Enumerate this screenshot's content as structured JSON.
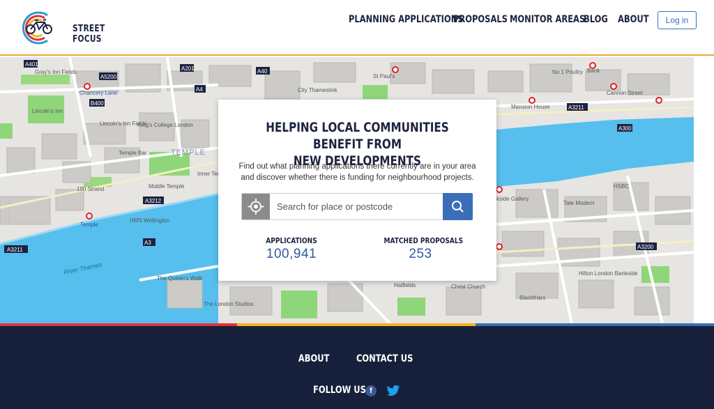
{
  "brand": {
    "line1": "STREET",
    "line2": "FOCUS",
    "colors": {
      "navy": "#1d2340",
      "blue": "#3a6fb8",
      "yellow": "#f2b51b",
      "red": "#e1323c",
      "teal": "#2c9ad1"
    }
  },
  "nav": {
    "items": [
      {
        "label": "PLANNING APPLICATIONS"
      },
      {
        "label": "PROPOSALS"
      },
      {
        "label": "MONITOR AREAS"
      },
      {
        "label": "BLOG"
      },
      {
        "label": "ABOUT"
      }
    ],
    "login_label": "Log in"
  },
  "map": {
    "labels": {
      "temple_area": "TEMPLE",
      "river": "River Thames",
      "hms": "HMS Wellington",
      "temple_stn": "Temple",
      "lincolns": "Lincoln's Inn",
      "lincolns_fields": "Lincoln's Inn Fields",
      "grays": "Gray's Inn Fields",
      "chancery": "Chancery Lane",
      "kings": "King's College London",
      "middle_temple": "Middle Temple",
      "inner_temple": "Inner Temple Garden",
      "strand190": "190 Strand",
      "queens_walk": "The Queen's Walk",
      "london_studios": "The London Studios",
      "mansion": "Mansion House",
      "cannon": "Cannon Street",
      "hsbc": "HSBC",
      "tate": "Tate Modern",
      "bankside": "kside Gallery",
      "christ": "Christ Church",
      "hilton": "Hilton London Bankside",
      "stpauls": "St Paul's",
      "city": "City Thameslink",
      "no1": "No 1 Poultry",
      "bank": "Bank",
      "temple_bar": "Temple Bar",
      "road_a3211_left": "A3211",
      "road_a3211_right": "A3211",
      "road_a3200": "A3200",
      "road_a300": "A300",
      "road_a4": "A4",
      "road_a40": "A40",
      "road_a401": "A401",
      "road_a5200": "A5200",
      "road_a3212": "A3212",
      "road_a201": "A201",
      "road_b400": "B400",
      "road_a3": "A3",
      "hatfields": "Hatfields",
      "blackfriars": "Blackfriars"
    }
  },
  "hero": {
    "title_line1": "HELPING LOCAL COMMUNITIES BENEFIT FROM",
    "title_line2": "NEW DEVELOPMENTS",
    "desc_line1": "Find out what planning applications there currently are in your area",
    "desc_line2": "and discover whether there is funding for neighbourhood projects.",
    "search_placeholder": "Search for place or postcode",
    "stats": [
      {
        "label": "APPLICATIONS",
        "value": "100,941"
      },
      {
        "label": "MATCHED PROPOSALS",
        "value": "253"
      }
    ]
  },
  "footer": {
    "links": [
      {
        "label": "ABOUT"
      },
      {
        "label": "CONTACT US"
      }
    ],
    "follow_label": "FOLLOW US",
    "facebook_glyph": "f"
  }
}
